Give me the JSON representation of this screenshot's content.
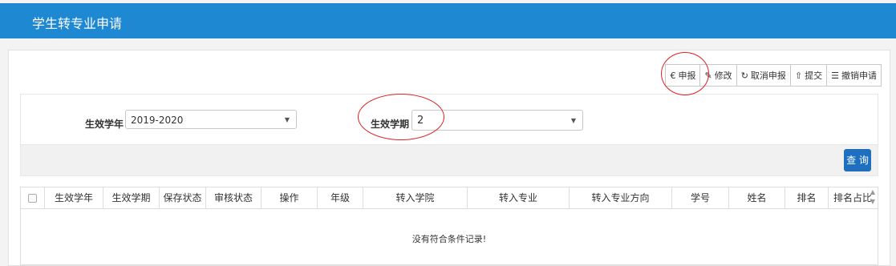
{
  "header": {
    "title": "学生转专业申请"
  },
  "toolbar": {
    "buttons": [
      {
        "icon": "euro-icon",
        "glyph": "€",
        "label": "申报"
      },
      {
        "icon": "edit-icon",
        "glyph": "✎",
        "label": "修改"
      },
      {
        "icon": "refresh-icon",
        "glyph": "↻",
        "label": "取消申报"
      },
      {
        "icon": "upload-icon",
        "glyph": "⇧",
        "label": "提交"
      },
      {
        "icon": "list-icon",
        "glyph": "☰",
        "label": "撤销申请"
      }
    ]
  },
  "filters": {
    "year_label": "生效学年",
    "year_value": "2019-2020",
    "term_label": "生效学期",
    "term_value": "2",
    "query_label": "查 询"
  },
  "table": {
    "columns": [
      "生效学年",
      "生效学期",
      "保存状态",
      "审核状态",
      "操作",
      "年级",
      "转入学院",
      "转入专业",
      "转入专业方向",
      "学号",
      "姓名",
      "排名",
      "排名占比"
    ],
    "empty_text": "没有符合条件记录!"
  },
  "colors": {
    "brand": "#1e88d2",
    "query_button": "#1e6fc0",
    "annotation": "#e02020"
  }
}
